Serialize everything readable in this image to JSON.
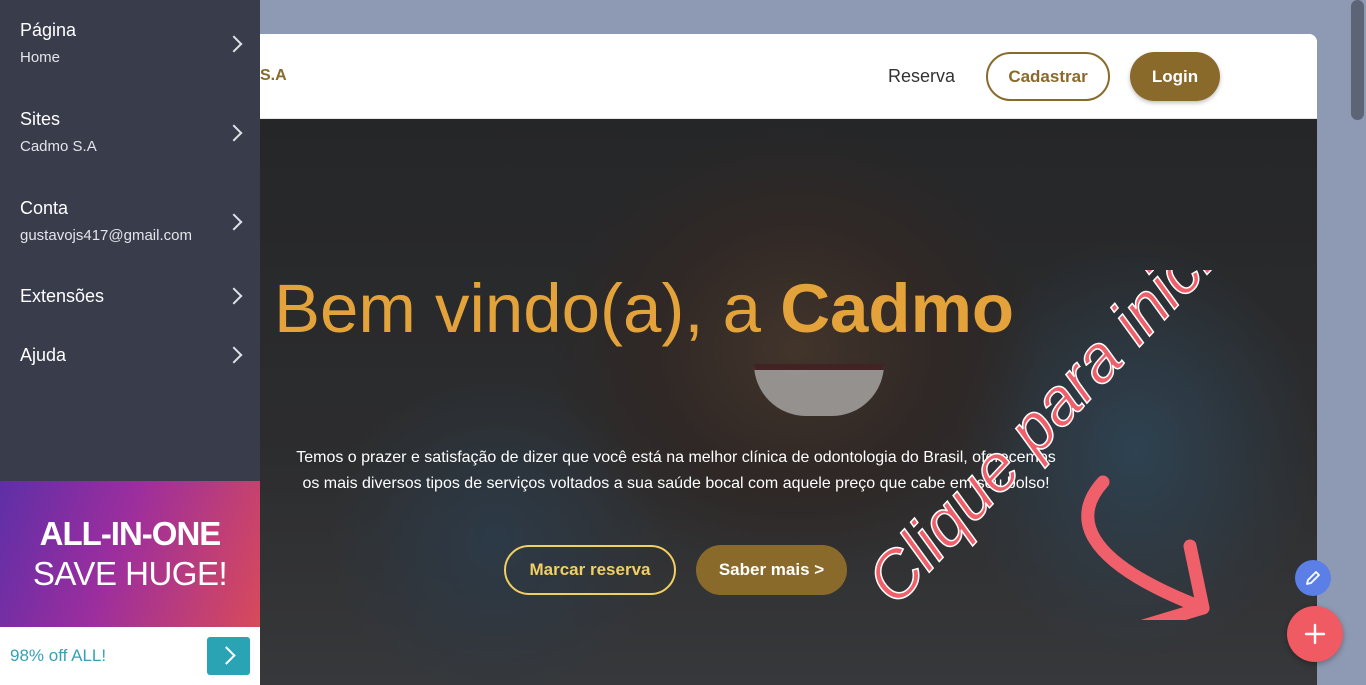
{
  "site": {
    "logo_text": "S.A",
    "nav": {
      "reserva": "Reserva",
      "cadastrar": "Cadastrar",
      "login": "Login"
    },
    "hero": {
      "title_normal": "Bem vindo(a), a ",
      "title_bold": "Cadmo",
      "text_line1": "Temos o prazer e satisfação de dizer que você está na melhor clínica de odontologia do Brasil, oferecemos",
      "text_line2": "os mais diversos tipos de serviços voltados a sua saúde bocal com aquele preço que cabe em seu bolso!",
      "btn_reserva": "Marcar reserva",
      "btn_saber": "Saber mais >"
    }
  },
  "sidebar": {
    "items": [
      {
        "label": "Página",
        "sub": "Home"
      },
      {
        "label": "Sites",
        "sub": "Cadmo S.A"
      },
      {
        "label": "Conta",
        "sub": "gustavojs417@gmail.com"
      },
      {
        "label": "Extensões",
        "sub": ""
      },
      {
        "label": "Ajuda",
        "sub": ""
      }
    ]
  },
  "promo": {
    "line1": "ALL-IN-ONE",
    "line2": "SAVE HUGE!",
    "bar_text": "98% off ALL!"
  },
  "annotation": {
    "text": "Clique para iniciar",
    "color": "#f0606a"
  },
  "colors": {
    "brand": "#8a6a2a",
    "hero_title": "#e3a33a",
    "sidebar_bg": "#393c4b",
    "fab_add": "#f05a62",
    "fab_edit": "#5b7fe6"
  },
  "icons": {
    "fab_edit": "pencil-icon",
    "fab_add": "plus-icon",
    "menu_arrow": "chevron-right-icon"
  }
}
